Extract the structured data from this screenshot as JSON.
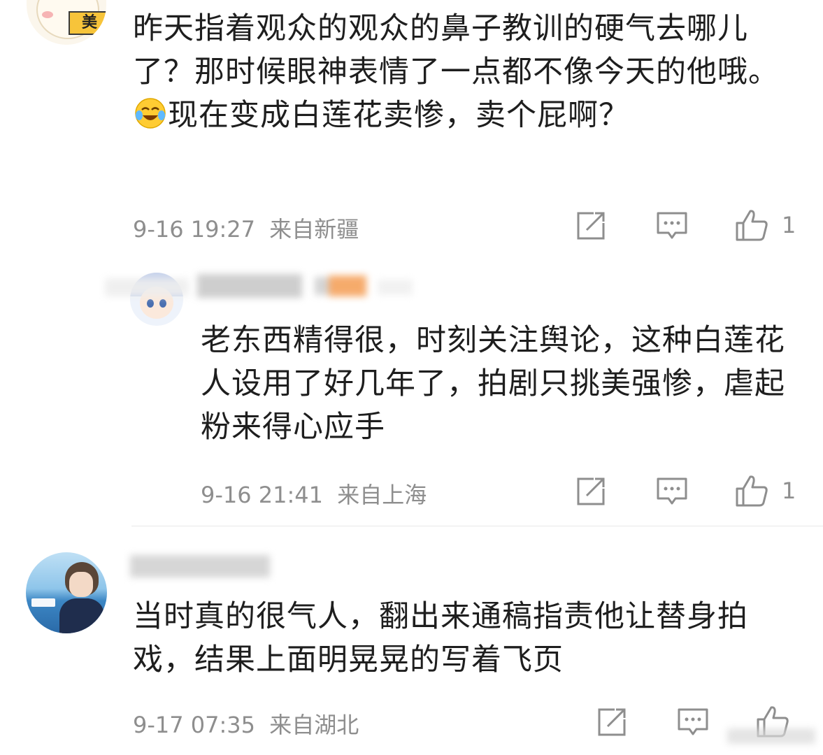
{
  "comments": [
    {
      "text": "昨天指着观众的观众的鼻子教训的硬气去哪儿了？那时候眼神表情了一点都不像今天的他哦。",
      "text_after_emoji": "现在变成白莲花卖惨，卖个屁啊？",
      "emoji": "laugh-cry-icon",
      "time": "9-16 19:27",
      "location": "来自新疆",
      "likes": "1"
    },
    {
      "text": "老东西精得很，时刻关注舆论，这种白莲花人设用了好几年了，拍剧只挑美强惨，虐起粉来得心应手",
      "time": "9-16 21:41",
      "location": "来自上海",
      "likes": "1"
    },
    {
      "text": "当时真的很气人，翻出来通稿指责他让替身拍戏，结果上面明晃晃的写着飞页",
      "time": "9-17 07:35",
      "location": "来自湖北"
    }
  ],
  "avatar1_badge": "美",
  "colors": {
    "meta": "#8e8e8e",
    "text": "#1e1e1e",
    "badge": "#f7c43a"
  }
}
